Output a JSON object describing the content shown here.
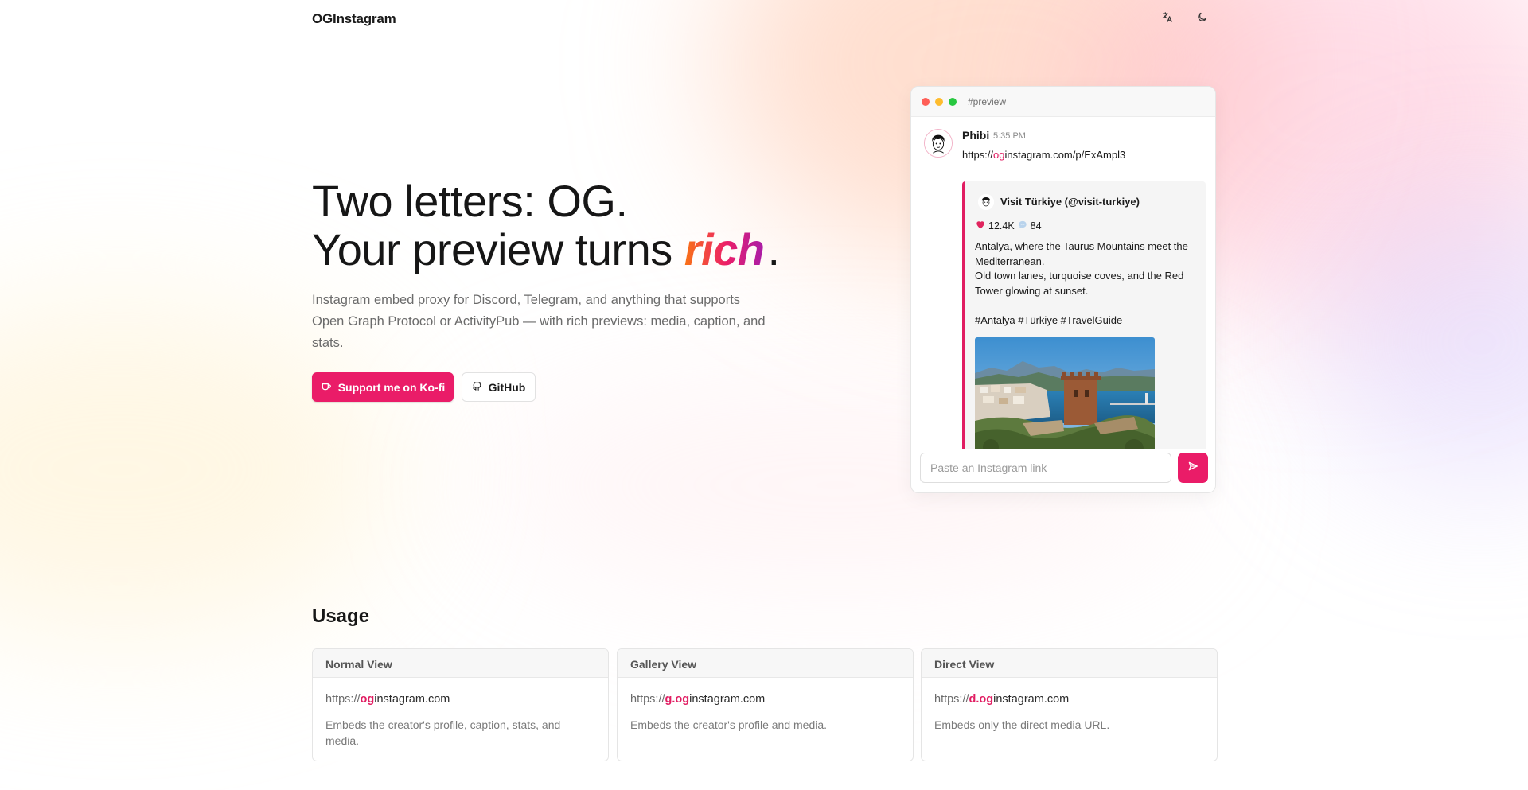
{
  "header": {
    "logo": "OGInstagram",
    "language_icon": "translate-icon",
    "theme_icon": "moon-icon"
  },
  "hero": {
    "title_line1": "Two letters: OG.",
    "title_line2_prefix": "Your preview turns ",
    "title_line2_highlight": "rich",
    "title_line2_suffix": ".",
    "subtitle": "Instagram embed proxy for Discord, Telegram, and anything that supports Open Graph Protocol or ActivityPub — with rich previews: media, caption, and stats.",
    "kofi_label": "Support me on Ko-fi",
    "github_label": "GitHub",
    "accent": "#ea1c68"
  },
  "preview": {
    "channel": "#preview",
    "message": {
      "username": "Phibi",
      "time": "5:35 PM",
      "link_prefix": "https://",
      "link_highlight": "og",
      "link_suffix": "instagram.com/p/ExAmpl3"
    },
    "embed": {
      "author": "Visit Türkiye (@visit-turkiye)",
      "likes": "12.4K",
      "comments": "84",
      "caption_lines": [
        "Antalya, where the Taurus Mountains meet the Mediterranean.",
        "Old town lanes, turquoise coves, and the Red Tower glowing at sunset.",
        "",
        "#Antalya #Türkiye #TravelGuide"
      ],
      "border_color": "#e11d62"
    },
    "input_placeholder": "Paste an Instagram link",
    "send_icon": "send-icon"
  },
  "usage": {
    "title": "Usage",
    "cards": [
      {
        "title": "Normal View",
        "url_prefix": "https://",
        "url_highlight": "og",
        "url_suffix": "instagram.com",
        "description": "Embeds the creator's profile, caption, stats, and media."
      },
      {
        "title": "Gallery View",
        "url_prefix": "https://",
        "url_highlight": "g.og",
        "url_suffix": "instagram.com",
        "description": "Embeds the creator's profile and media."
      },
      {
        "title": "Direct View",
        "url_prefix": "https://",
        "url_highlight": "d.og",
        "url_suffix": "instagram.com",
        "description": "Embeds only the direct media URL."
      }
    ]
  }
}
